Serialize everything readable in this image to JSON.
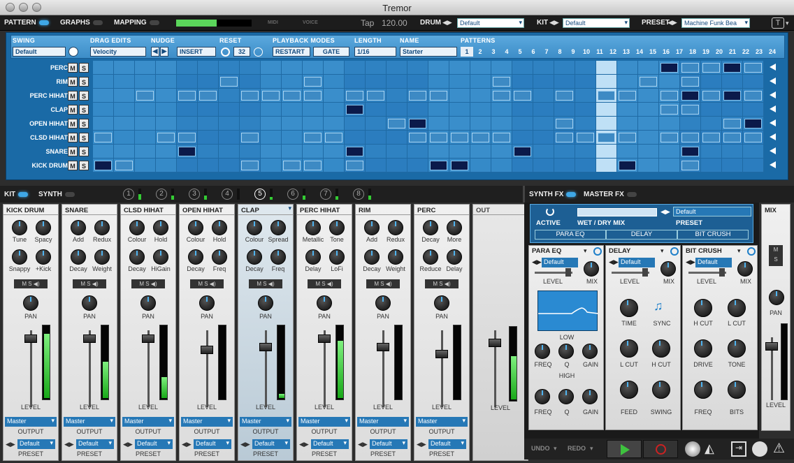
{
  "window": {
    "title": "Tremor"
  },
  "topbar": {
    "pattern": "PATTERN",
    "graphs": "GRAPHS",
    "mapping": "MAPPING",
    "midi": "MIDI",
    "voice": "VOICE",
    "tap": "Tap",
    "tempo": "120.00",
    "drum": "DRUM",
    "drum_value": "Default",
    "kit": "KIT",
    "kit_value": "Default",
    "preset": "PRESET",
    "preset_value": "Machine Funk Bea"
  },
  "header": {
    "swing": "SWING",
    "swing_value": "Default",
    "drag": "DRAG EDITS",
    "drag_value": "Velocity",
    "nudge": "NUDGE",
    "insert": "INSERT",
    "reset": "RESET",
    "reset_value": "32",
    "playback": "PLAYBACK MODES",
    "restart": "RESTART",
    "gate": "GATE",
    "length": "LENGTH",
    "length_value": "1/16",
    "name": "NAME",
    "name_value": "Starter",
    "patterns": "PATTERNS",
    "pattern_nums": [
      "1",
      "2",
      "3",
      "4",
      "5",
      "6",
      "7",
      "8",
      "9",
      "10",
      "11",
      "12",
      "13",
      "14",
      "15",
      "16",
      "17",
      "18",
      "19",
      "20",
      "21",
      "22",
      "23",
      "24"
    ],
    "active_pattern": "1"
  },
  "tracks": [
    "PERC",
    "RIM",
    "PERC HIHAT",
    "CLAP",
    "OPEN HIHAT",
    "CLSD HIHAT",
    "SNARE",
    "KICK DRUM"
  ],
  "ms": {
    "m": "M",
    "s": "S"
  },
  "midbar": {
    "kit": "KIT",
    "synth": "SYNTH",
    "slots": [
      "1",
      "2",
      "3",
      "4",
      "5",
      "6",
      "7",
      "8"
    ],
    "synthfx": "SYNTH FX",
    "masterfx": "MASTER FX"
  },
  "channels": [
    {
      "name": "KICK DRUM",
      "k": [
        "Tune",
        "Spacy",
        "Snappy",
        "+Kick"
      ]
    },
    {
      "name": "SNARE",
      "k": [
        "Add",
        "Redux",
        "Decay",
        "Weight"
      ]
    },
    {
      "name": "CLSD HIHAT",
      "k": [
        "Colour",
        "Hold",
        "Decay",
        "HiGain"
      ]
    },
    {
      "name": "OPEN HIHAT",
      "k": [
        "Colour",
        "Hold",
        "Decay",
        "Freq"
      ]
    },
    {
      "name": "CLAP",
      "k": [
        "Colour",
        "Spread",
        "Decay",
        "Freq"
      ]
    },
    {
      "name": "PERC HIHAT",
      "k": [
        "Metallic",
        "Tone",
        "Delay",
        "LoFi"
      ]
    },
    {
      "name": "RIM",
      "k": [
        "Add",
        "Redux",
        "Decay",
        "Weight"
      ]
    },
    {
      "name": "PERC",
      "k": [
        "Decay",
        "More",
        "Reduce",
        "Delay"
      ]
    }
  ],
  "strip": {
    "ms": "M S ◀)",
    "pan": "PAN",
    "level": "LEVEL",
    "output": "OUTPUT",
    "output_value": "Master",
    "preset": "PRESET",
    "preset_value": "Default",
    "out": "OUT",
    "mix": "MIX"
  },
  "fx": {
    "active": "ACTIVE",
    "wetdry": "WET / DRY MIX",
    "preset": "PRESET",
    "preset_value": "Default",
    "tabs": [
      "PARA EQ",
      "DELAY",
      "BIT CRUSH"
    ],
    "paraeq": {
      "title": "PARA EQ",
      "val": "Default",
      "level": "LEVEL",
      "mix": "MIX",
      "low": "LOW",
      "high": "HIGH",
      "freq": "FREQ",
      "q": "Q",
      "gain": "GAIN"
    },
    "delay": {
      "title": "DELAY",
      "val": "Default",
      "level": "LEVEL",
      "mix": "MIX",
      "time": "TIME",
      "sync": "SYNC",
      "lcut": "L CUT",
      "hcut": "H CUT",
      "feed": "FEED",
      "swing": "SWING"
    },
    "bitcrush": {
      "title": "BIT CRUSH",
      "val": "Default",
      "level": "LEVEL",
      "mix": "MIX",
      "hcut": "H CUT",
      "lcut": "L CUT",
      "drive": "DRIVE",
      "tone": "TONE",
      "freq": "FREQ",
      "bits": "BITS"
    }
  },
  "bottom": {
    "undo": "UNDO",
    "redo": "REDO"
  }
}
